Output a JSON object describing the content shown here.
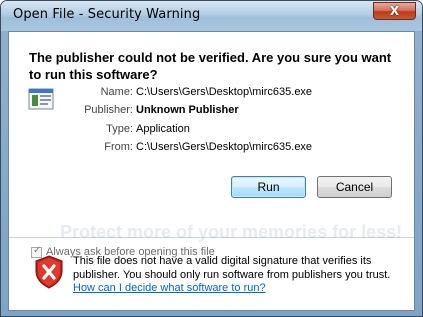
{
  "window": {
    "title": "Open File - Security Warning",
    "close_glyph": "X"
  },
  "dialog": {
    "headline": "The publisher could not be verified.  Are you sure you want to run this software?",
    "fields": [
      {
        "label": "Name:",
        "value": "C:\\Users\\Gers\\Desktop\\mirc635.exe",
        "bold": false
      },
      {
        "label": "Publisher:",
        "value": "Unknown Publisher",
        "bold": true
      },
      {
        "label": "Type:",
        "value": "Application",
        "bold": false
      },
      {
        "label": "From:",
        "value": "C:\\Users\\Gers\\Desktop\\mirc635.exe",
        "bold": false
      }
    ],
    "buttons": {
      "run": "Run",
      "cancel": "Cancel"
    },
    "checkbox": {
      "label": "Always ask before opening this file",
      "checked": true
    },
    "warning_text": "This file does not have a valid digital signature that verifies its publisher.  You should only run software from publishers you trust.",
    "help_link": "How can I decide what software to run?"
  },
  "watermark": "Protect more of your memories for less!",
  "icons": {
    "app": "application-icon",
    "warning": "security-shield-icon"
  },
  "colors": {
    "link": "#0066cc",
    "close_button": "#c9582f",
    "default_button_border": "#3c7fb1"
  }
}
